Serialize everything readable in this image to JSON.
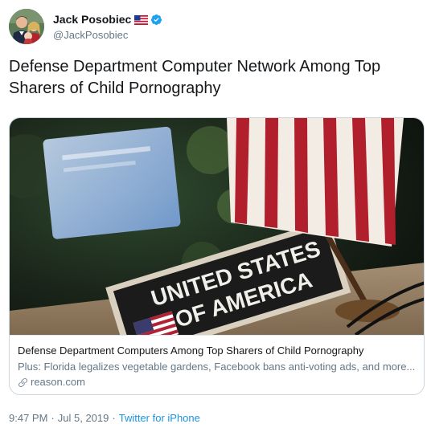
{
  "author": {
    "display_name": "Jack Posobiec",
    "handle": "@JackPosobiec",
    "name_emoji": "us-flag-emoji",
    "verified": true,
    "verified_icon": "verified-badge-icon",
    "verified_color": "#1da1f2"
  },
  "tweet": {
    "text": "Defense Department Computer Network Among Top Sharers of Child Pornography"
  },
  "card": {
    "image_description_icon": "us-flag-desk-nameplate-photo",
    "nameplate_text_line1": "UNITED STATES",
    "nameplate_text_line2": "OF AMERICA",
    "title": "Defense Department Computers Among Top Sharers of Child Pornography",
    "description": "Plus: Florida legalizes vegetable gardens, Facebook bans anti-voting ads, and more...",
    "domain": "reason.com",
    "domain_icon": "link-icon"
  },
  "meta": {
    "time": "9:47 PM",
    "separator": "·",
    "date": "Jul 5, 2019",
    "separator2": "·",
    "source": "Twitter for iPhone"
  },
  "colors": {
    "text_primary": "#14171a",
    "text_secondary": "#657786",
    "link": "#1b95e0",
    "border": "#ccd6dd"
  }
}
